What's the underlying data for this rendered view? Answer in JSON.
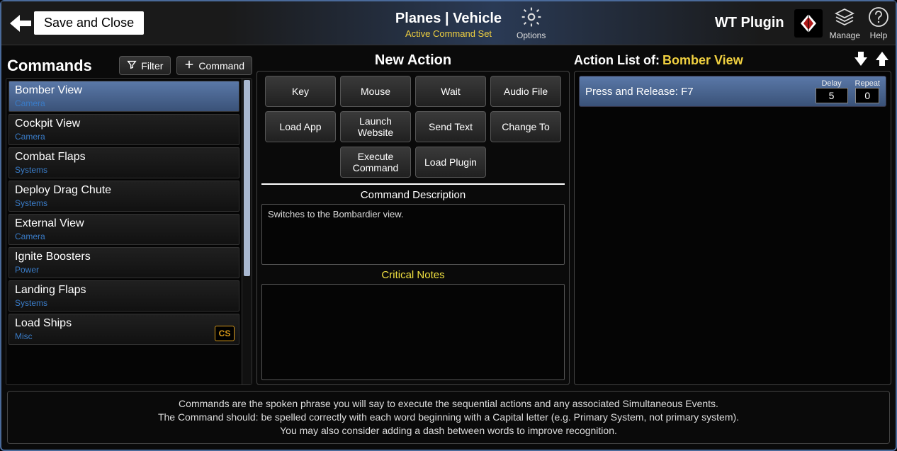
{
  "header": {
    "save_close": "Save and Close",
    "title_main": "Planes  |  Vehicle",
    "title_sub": "Active Command Set",
    "options_label": "Options",
    "plugin_name": "WT Plugin",
    "manage_label": "Manage",
    "help_label": "Help"
  },
  "left": {
    "title": "Commands",
    "filter_label": "Filter",
    "add_label": "Command",
    "items": [
      {
        "name": "Bomber View",
        "cat": "Camera",
        "selected": true,
        "badge": ""
      },
      {
        "name": "Cockpit View",
        "cat": "Camera",
        "selected": false,
        "badge": ""
      },
      {
        "name": "Combat Flaps",
        "cat": "Systems",
        "selected": false,
        "badge": ""
      },
      {
        "name": "Deploy Drag Chute",
        "cat": "Systems",
        "selected": false,
        "badge": ""
      },
      {
        "name": "External View",
        "cat": "Camera",
        "selected": false,
        "badge": ""
      },
      {
        "name": "Ignite Boosters",
        "cat": "Power",
        "selected": false,
        "badge": ""
      },
      {
        "name": "Landing Flaps",
        "cat": "Systems",
        "selected": false,
        "badge": ""
      },
      {
        "name": "Load Ships",
        "cat": "Misc",
        "selected": false,
        "badge": "CS"
      }
    ]
  },
  "mid": {
    "title": "New Action",
    "buttons": [
      "Key",
      "Mouse",
      "Wait",
      "Audio File",
      "Load App",
      "Launch Website",
      "Send Text",
      "Change To",
      "Execute Command",
      "Load Plugin"
    ],
    "desc_label": "Command Description",
    "desc_text": "Switches to the Bombardier view.",
    "notes_label": "Critical Notes",
    "notes_text": ""
  },
  "right": {
    "title_prefix": "Action List of:",
    "title_target": "Bomber View",
    "delay_label": "Delay",
    "repeat_label": "Repeat",
    "actions": [
      {
        "label": "Press and Release:  F7",
        "delay": "5",
        "repeat": "0"
      }
    ]
  },
  "hint": {
    "l1": "Commands are the spoken phrase you will say to execute the sequential actions and any associated Simultaneous Events.",
    "l2": "The Command should: be spelled correctly with each word beginning with a Capital letter (e.g. Primary System, not primary system).",
    "l3": "You may also consider adding a dash between words to improve recognition."
  }
}
